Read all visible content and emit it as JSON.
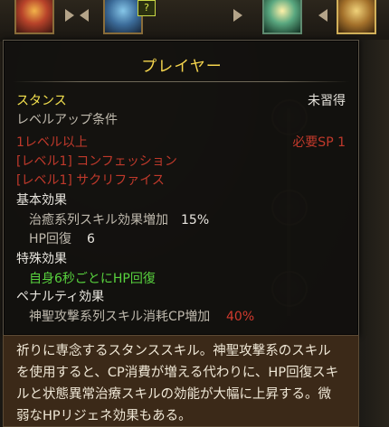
{
  "tooltip": {
    "title": "プレイヤー",
    "skill_name": "スタンス",
    "learned_status": "未習得",
    "levelup_header": "レベルアップ条件",
    "requirements": [
      "1レベル以上",
      "[レベル1] コンフェッション",
      "[レベル1] サクリファイス"
    ],
    "required_sp": "必要SP 1",
    "basic_effect_header": "基本効果",
    "basic_effects": [
      {
        "label": "治癒系列スキル効果増加",
        "value": "15%"
      },
      {
        "label": "HP回復",
        "value": "6"
      }
    ],
    "special_effect_header": "特殊効果",
    "special_effect": "自身6秒ごとにHP回復",
    "penalty_header": "ペナルティ効果",
    "penalty": {
      "label": "神聖攻撃系列スキル消耗CP増加",
      "value": "40%"
    }
  },
  "description": {
    "lines": [
      "祈りに専念するスタンススキル。神聖攻撃系のスキル",
      "を使用すると、CP消費が増える代わりに、HP回復スキ",
      "ルと状態異常治療スキルの効能が大幅に上昇する。微",
      "弱なHPリジェネ効果もある。"
    ]
  },
  "skill_tree": {
    "locked_badge": "?"
  },
  "colors": {
    "title": "#f5d54d",
    "requirement_unmet": "#c0392b",
    "special_effect": "#58d23e",
    "penalty_value": "#d23a2e",
    "description_bg": "#3b2918"
  }
}
